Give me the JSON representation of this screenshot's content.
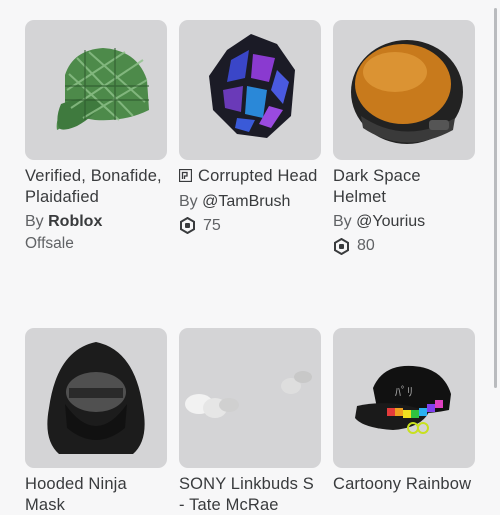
{
  "items": [
    {
      "name": "Verified, Bonafide, Plaidafied",
      "by": "By",
      "creator": "Roblox",
      "status": "Offsale",
      "icon": "green-plaid-cap"
    },
    {
      "name": "Corrupted Head",
      "by": "By",
      "creator": "@TamBrush",
      "price": "75",
      "icon": "corrupted-head"
    },
    {
      "name": "Dark Space Helmet",
      "by": "By",
      "creator": "@Yourius",
      "price": "80",
      "icon": "space-helmet"
    },
    {
      "name": "Hooded Ninja Mask",
      "icon": "ninja-mask"
    },
    {
      "name": "SONY Linkbuds S - Tate McRae",
      "icon": "earbuds"
    },
    {
      "name": "Cartoony Rainbow",
      "icon": "rainbow-cap"
    }
  ],
  "colors": {
    "thumb_bg": "#d4d4d6",
    "page_bg": "#f7f7f8",
    "text": "#393b3d",
    "muted": "#606265"
  }
}
